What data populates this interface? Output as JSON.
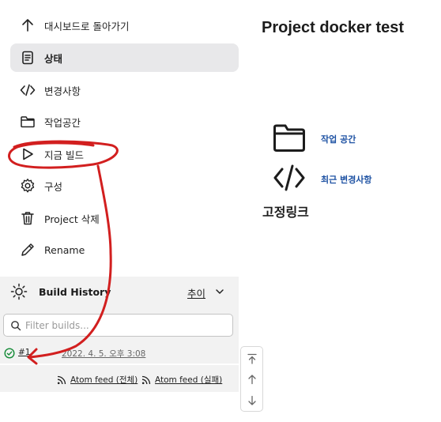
{
  "sidebar": {
    "items": [
      {
        "label": "대시보드로 돌아가기",
        "icon": "arrow-up-icon"
      },
      {
        "label": "상태",
        "icon": "document-icon"
      },
      {
        "label": "변경사항",
        "icon": "code-icon"
      },
      {
        "label": "작업공간",
        "icon": "folder-icon"
      },
      {
        "label": "지금 빌드",
        "icon": "play-icon"
      },
      {
        "label": "구성",
        "icon": "gear-icon"
      },
      {
        "label": "Project 삭제",
        "icon": "trash-icon"
      },
      {
        "label": "Rename",
        "icon": "pencil-icon"
      }
    ],
    "active_index": 1
  },
  "build_history": {
    "title": "Build History",
    "trend_label": "추이",
    "filter_placeholder": "Filter builds...",
    "builds": [
      {
        "number": "#1",
        "date": "2022. 4. 5. 오후 3:08",
        "status": "success"
      }
    ],
    "feeds": {
      "all_label": "Atom feed (전체)",
      "failed_label": "Atom feed (실패)"
    }
  },
  "main": {
    "title": "Project docker test",
    "links": [
      {
        "label": "작업 공간",
        "icon": "folder-icon"
      },
      {
        "label": "최근 변경사항",
        "icon": "code-icon"
      }
    ],
    "permalinks_title": "고정링크"
  },
  "colors": {
    "link": "#1e52a3",
    "active_bg": "#e8e8ea",
    "panel_bg": "#f2f2f2",
    "success": "#138a36",
    "annotation": "#d21f1f"
  }
}
